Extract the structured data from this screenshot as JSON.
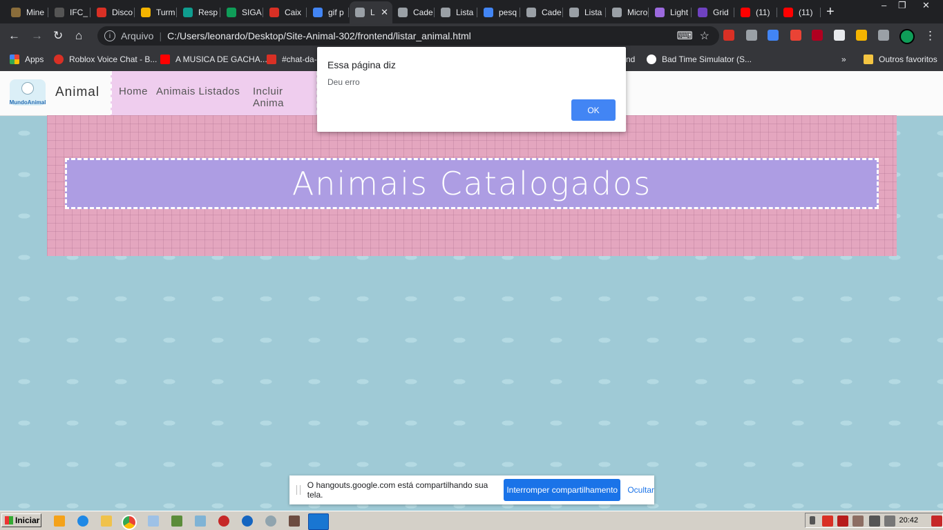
{
  "browser": {
    "tabs": [
      {
        "label": "Mine",
        "color": "#8a6d3b"
      },
      {
        "label": "IFC_",
        "color": "#555555"
      },
      {
        "label": "Disco",
        "color": "#d93025"
      },
      {
        "label": "Turm",
        "color": "#f4b400"
      },
      {
        "label": "Resp",
        "color": "#0f9d8f"
      },
      {
        "label": "SIGA",
        "color": "#0f9d58"
      },
      {
        "label": "Caix",
        "color": "#d93025"
      },
      {
        "label": "gif p",
        "color": "#4285f4"
      },
      {
        "label": "L",
        "color": "#9aa0a6"
      },
      {
        "label": "Cade",
        "color": "#9aa0a6"
      },
      {
        "label": "Lista",
        "color": "#9aa0a6"
      },
      {
        "label": "pesq",
        "color": "#4285f4"
      },
      {
        "label": "Cade",
        "color": "#9aa0a6"
      },
      {
        "label": "Lista",
        "color": "#9aa0a6"
      },
      {
        "label": "Micro",
        "color": "#9aa0a6"
      },
      {
        "label": "Light",
        "color": "#9c6ade"
      },
      {
        "label": "Grid",
        "color": "#6f42c1"
      },
      {
        "label": "(11)",
        "color": "#ff0000"
      },
      {
        "label": "(11)",
        "color": "#ff0000"
      }
    ],
    "active_tab_index": 8,
    "new_tab": "+",
    "window_controls": {
      "minimize": "–",
      "restore": "❐",
      "close": "✕"
    },
    "address": {
      "scheme_label": "Arquivo",
      "url": "C:/Users/leonardo/Desktop/Site-Animal-302/frontend/listar_animal.html"
    },
    "bookmarks": [
      {
        "label": "Apps",
        "color": "#f4b400"
      },
      {
        "label": "Roblox Voice Chat - B...",
        "color": "#d93025"
      },
      {
        "label": "A MUSICA DE GACHA...",
        "color": "#ff0000"
      },
      {
        "label": "#chat-da-",
        "color": "#d93025"
      },
      {
        "label": "nd",
        "color": ""
      },
      {
        "label": "Bad Time Simulator (S...",
        "color": "#ffffff"
      }
    ],
    "bookmarks_overflow": "»",
    "other_bookmarks": "Outros favoritos"
  },
  "site": {
    "brand": "Animal",
    "logo_text": "MundoAnimal",
    "nav": [
      "Home",
      "Animais Listados",
      "Incluir Anima"
    ],
    "page_title": "Animais Catalogados"
  },
  "dialog": {
    "title": "Essa página diz",
    "message": "Deu erro",
    "ok": "OK"
  },
  "share_bar": {
    "message": "O hangouts.google.com está compartilhando sua tela.",
    "stop": "Interromper compartilhamento",
    "hide": "Ocultar"
  },
  "taskbar": {
    "start": "Iniciar",
    "clock": "20:42"
  }
}
